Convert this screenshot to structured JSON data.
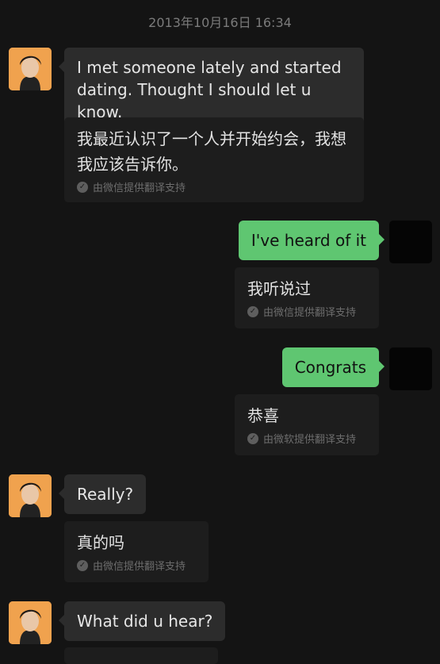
{
  "timestamp": "2013年10月16日 16:34",
  "messages": [
    {
      "text": "I met someone lately and started dating.  Thought I should let u know.",
      "translation": "我最近认识了一个人并开始约会，我想我应该告诉你。",
      "credit": "由微信提供翻译支持",
      "avatar_icon": "person-avatar-icon"
    },
    {
      "text": "I've heard of it",
      "translation": "我听说过",
      "credit": "由微信提供翻译支持"
    },
    {
      "text": "Congrats",
      "translation": "恭喜",
      "credit": "由微软提供翻译支持"
    },
    {
      "text": "Really?",
      "translation": "真的吗",
      "credit": "由微信提供翻译支持"
    },
    {
      "text": "What did u hear?"
    }
  ],
  "colors": {
    "background": "#141414",
    "incoming_bubble": "#2c2c2c",
    "outgoing_bubble": "#5fc671",
    "translation_box": "#1d1d1d",
    "avatar_other": "#f0a24e"
  }
}
